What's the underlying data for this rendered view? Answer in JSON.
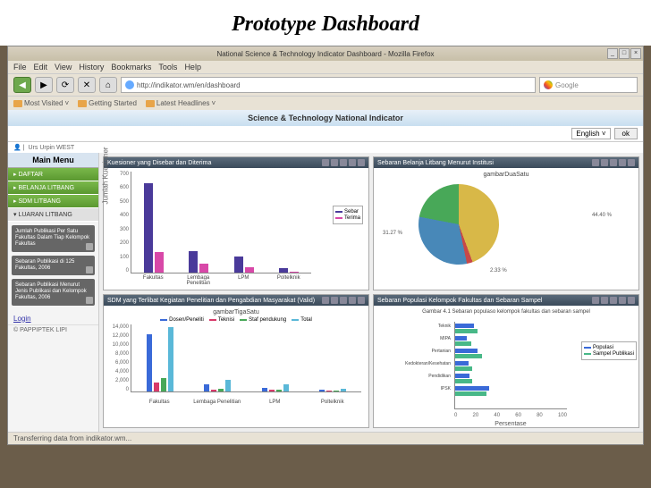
{
  "slide_title": "Prototype Dashboard",
  "window_title": "National Science & Technology Indicator Dashboard - Mozilla Firefox",
  "menubar": [
    "File",
    "Edit",
    "View",
    "History",
    "Bookmarks",
    "Tools",
    "Help"
  ],
  "url": "http://indikator.wm/en/dashboard",
  "search_placeholder": "Google",
  "bookmarks": [
    "Most Visited",
    "Getting Started",
    "Latest Headlines"
  ],
  "banner": "Science & Technology National Indicator",
  "lang": {
    "selected": "English",
    "ok": "ok"
  },
  "user": "Urs Urpin WEST",
  "main_menu_title": "Main Menu",
  "menu_items": [
    "DAFTAR",
    "BELANJA LITBANG",
    "SDM LITBANG",
    "LUARAN LITBANG"
  ],
  "sub_items": [
    "Jumlah Publikasi Per Satu Fakultas Dalam Tiap Kelompok Fakultas",
    "Sebaran Publikasi di 125 Fakultas, 2006",
    "Sebaran Publikasi Menurut Jenis Publikasi dan Kelompok Fakultas, 2006"
  ],
  "login": "Login",
  "copyright": "© PAPPIPTEK LIPI",
  "status": "Transferring data from indikator.wm...",
  "panels": {
    "p1": {
      "title": "Kuesioner yang Disebar dan Diterima",
      "ylabel": "Jumlah Kuesioner"
    },
    "p2": {
      "title": "Sebaran Belanja Litbang Menurut Institusi",
      "subtitle": "gambarDuaSatu"
    },
    "p3": {
      "title": "SDM yang Terlibat Kegiatan Penelitian dan Pengabdian Masyarakat (Valid)",
      "subtitle": "gambarTigaSatu"
    },
    "p4": {
      "title": "Sebaran Populasi Kelompok Fakultas dan Sebaran Sampel",
      "subtitle": "Gambar 4.1 Sebaran populaso kelompok fakultas dan sebaran sampel",
      "xlabel": "Persentase"
    }
  },
  "chart_data": [
    {
      "type": "bar",
      "title": "Kuesioner yang Disebar dan Diterima",
      "ylabel": "Jumlah Kuesioner",
      "categories": [
        "Fakultas",
        "Lembaga Penelitian",
        "LPM",
        "Poltelknik"
      ],
      "series": [
        {
          "name": "Sebar",
          "color": "#4a3a9a",
          "values": [
            620,
            150,
            110,
            30
          ]
        },
        {
          "name": "Terima",
          "color": "#d848a8",
          "values": [
            140,
            60,
            40,
            8
          ]
        }
      ],
      "ylim": [
        0,
        700
      ],
      "yticks": [
        0,
        100,
        200,
        300,
        400,
        500,
        600,
        700
      ]
    },
    {
      "type": "pie",
      "title": "gambarDuaSatu",
      "slices": [
        {
          "label": "44.40 %",
          "value": 44.4,
          "color": "#d8b848"
        },
        {
          "label": "2.33 %",
          "value": 2.33,
          "color": "#c84848"
        },
        {
          "label": "31.27 %",
          "value": 31.27,
          "color": "#4888b8"
        },
        {
          "label": "",
          "value": 22.0,
          "color": "#48a858"
        }
      ]
    },
    {
      "type": "bar",
      "title": "gambarTigaSatu",
      "categories": [
        "Fakultas",
        "Lembaga Penelitian",
        "LPM",
        "Poltelknik"
      ],
      "series": [
        {
          "name": "Dosen/Peneliti",
          "color": "#3a6ad8",
          "values": [
            12000,
            1500,
            800,
            400
          ]
        },
        {
          "name": "Teknisi",
          "color": "#d83a6a",
          "values": [
            1800,
            400,
            300,
            100
          ]
        },
        {
          "name": "Staf pendukung",
          "color": "#48a858",
          "values": [
            2800,
            600,
            400,
            150
          ]
        },
        {
          "name": "Total",
          "color": "#5ab8d8",
          "values": [
            13500,
            2500,
            1500,
            650
          ]
        }
      ],
      "ylim": [
        0,
        14000
      ],
      "yticks": [
        0,
        2000,
        4000,
        6000,
        8000,
        10000,
        12000,
        14000
      ]
    },
    {
      "type": "bar_horizontal",
      "title": "Gambar 4.1 Sebaran populaso kelompok fakultas dan sebaran sampel",
      "xlabel": "Persentase",
      "categories": [
        "Teknik",
        "MIPA",
        "Pertanian",
        "Kedokteran/Kesehatan",
        "Pendidikan",
        "IPSK"
      ],
      "series": [
        {
          "name": "Populasi",
          "color": "#3a6ad8",
          "values": [
            17,
            10,
            20,
            12,
            13,
            30
          ]
        },
        {
          "name": "Sampel Publikasi",
          "color": "#48b888",
          "values": [
            20,
            14,
            24,
            15,
            15,
            28
          ]
        }
      ],
      "xlim": [
        0,
        100
      ],
      "xticks": [
        0,
        20,
        40,
        60,
        80,
        100
      ]
    }
  ]
}
